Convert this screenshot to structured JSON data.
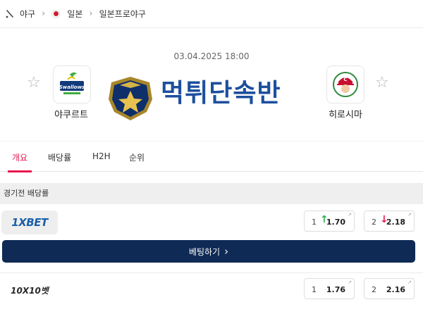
{
  "breadcrumb": {
    "items": [
      "야구",
      "일본",
      "일본프로야구"
    ]
  },
  "match": {
    "datetime": "03.04.2025 18:00",
    "home_team": "야쿠르트",
    "away_team": "히로시마"
  },
  "watermark": {
    "text": "먹튀단속반"
  },
  "tabs": [
    "개요",
    "배당률",
    "H2H",
    "순위"
  ],
  "active_tab": "개요",
  "odds_section": {
    "title": "경기전 배당률",
    "bet_button_label": "베팅하기",
    "bookmakers": [
      {
        "name": "1XBET",
        "odds": [
          {
            "label": "1",
            "value": "1.70",
            "trend": "up"
          },
          {
            "label": "2",
            "value": "2.18",
            "trend": "down"
          }
        ]
      },
      {
        "name": "10X10벳",
        "odds": [
          {
            "label": "1",
            "value": "1.76",
            "trend": "none"
          },
          {
            "label": "2",
            "value": "2.16",
            "trend": "none"
          }
        ]
      }
    ]
  },
  "colors": {
    "accent": "#e8174f",
    "bet_button": "#0e2a55",
    "odds_up": "#2bb34a",
    "odds_down": "#e8174f",
    "watermark": "#1d4f9d"
  },
  "icons": [
    "bat-icon",
    "japan-flag-icon",
    "chevron-right-icon",
    "star-icon",
    "team-logo",
    "external-link-icon",
    "arrow-up-icon",
    "arrow-down-icon"
  ]
}
